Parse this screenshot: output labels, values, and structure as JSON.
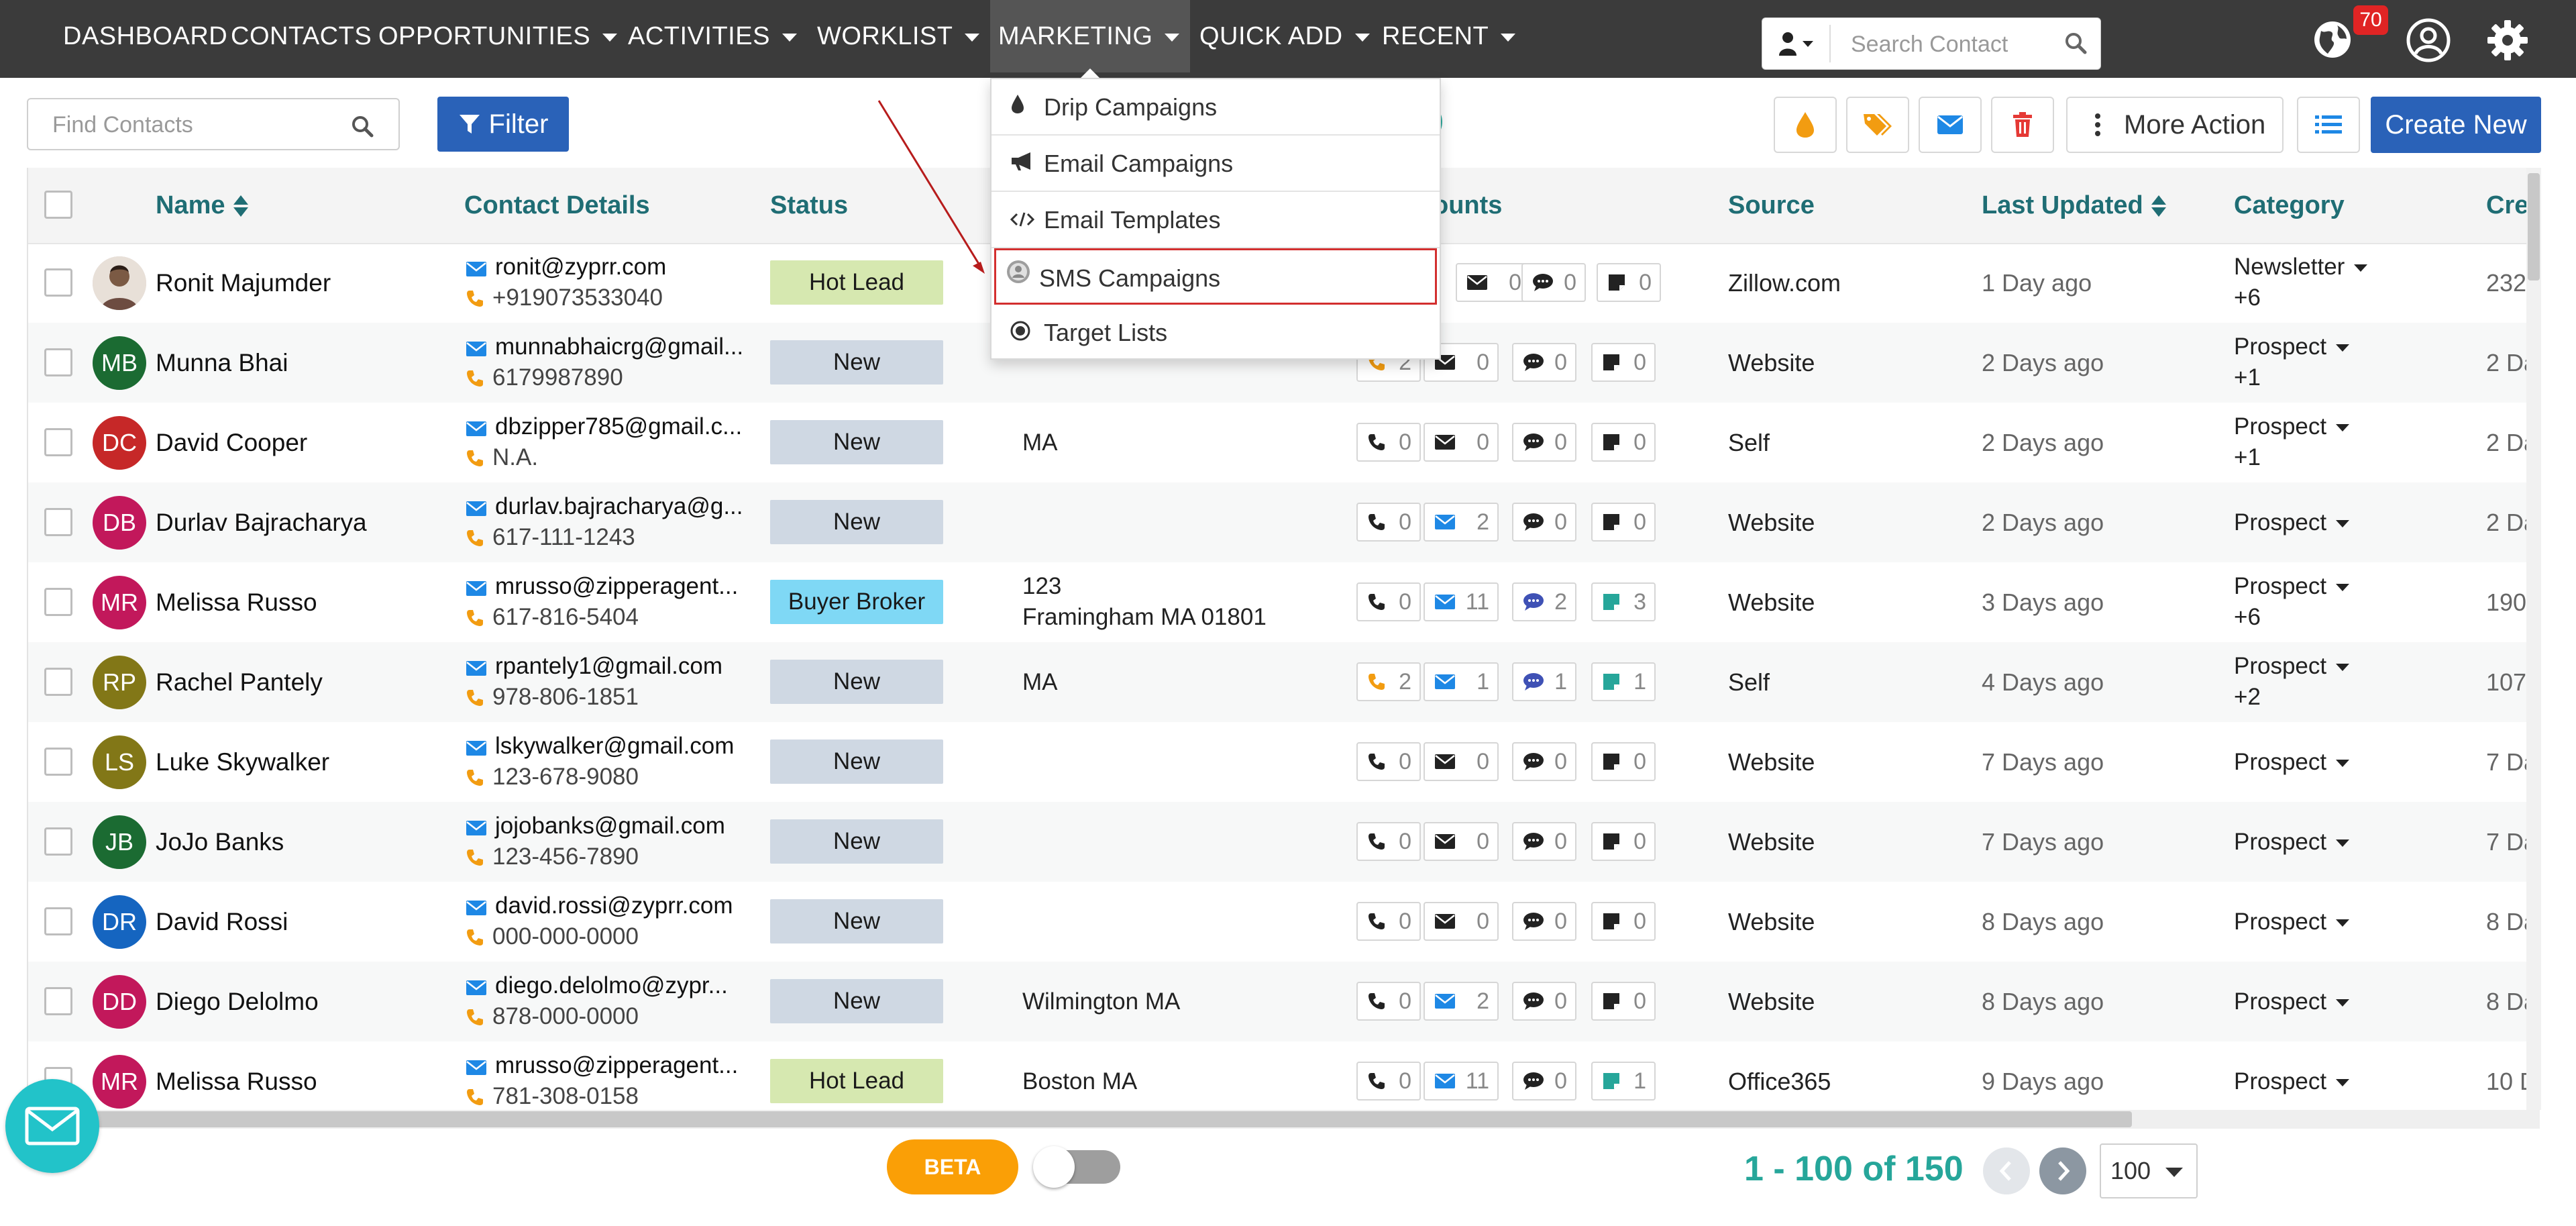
{
  "nav": {
    "items": [
      {
        "label": "DASHBOARD",
        "dropdown": false
      },
      {
        "label": "CONTACTS",
        "dropdown": false
      },
      {
        "label": "OPPORTUNITIES",
        "dropdown": true
      },
      {
        "label": "ACTIVITIES",
        "dropdown": true
      },
      {
        "label": "WORKLIST",
        "dropdown": true
      },
      {
        "label": "MARKETING",
        "dropdown": true,
        "active": true
      },
      {
        "label": "QUICK ADD",
        "dropdown": true
      },
      {
        "label": "RECENT",
        "dropdown": true
      }
    ],
    "search_placeholder": "Search Contact",
    "notification_count": "70",
    "icons": [
      "user-icon",
      "search-icon",
      "globe-icon",
      "account-circle-icon",
      "gear-icon"
    ]
  },
  "toolbar": {
    "find_placeholder": "Find Contacts",
    "filter_label": "Filter",
    "title_fragment": "s)",
    "more_action_label": "More Action",
    "create_new_label": "Create New",
    "icon_buttons": [
      "drip-icon",
      "tag-icon",
      "email-icon",
      "trash-icon"
    ]
  },
  "marketing_menu": {
    "items": [
      {
        "label": "Drip Campaigns",
        "icon": "drip-icon"
      },
      {
        "label": "Email Campaigns",
        "icon": "megaphone-icon"
      },
      {
        "label": "Email Templates",
        "icon": "code-icon"
      },
      {
        "label": "SMS Campaigns",
        "icon": "sms-icon",
        "highlighted": true
      },
      {
        "label": "Target Lists",
        "icon": "target-icon"
      }
    ]
  },
  "table": {
    "columns": [
      "Name",
      "Contact Details",
      "Status",
      "ounts",
      "Source",
      "Last Updated",
      "Category",
      "Cre"
    ],
    "rows": [
      {
        "initials": "",
        "photo": true,
        "color": "#6d4c41",
        "name": "Ronit Majumder",
        "email": "ronit@zyprr.com",
        "phone": "+919073533040",
        "status": "Hot Lead",
        "addr1": "",
        "addr2": "",
        "calls": "",
        "emails": "0",
        "sms": "0",
        "notes": "0",
        "source": "Zillow.com",
        "updated": "1 Day ago",
        "category": "Newsletter",
        "cat_more": "+6",
        "created": "232"
      },
      {
        "initials": "MB",
        "color": "#1b6b32",
        "name": "Munna Bhai",
        "email": "munnabhaicrg@gmail...",
        "phone": "6179987890",
        "status": "New",
        "addr1": "",
        "addr2": "",
        "calls": "2",
        "emails": "0",
        "sms": "0",
        "notes": "0",
        "source": "Website",
        "updated": "2 Days ago",
        "category": "Prospect",
        "cat_more": "+1",
        "created": "2 Da"
      },
      {
        "initials": "DC",
        "color": "#c62828",
        "name": "David Cooper",
        "email": "dbzipper785@gmail.c...",
        "phone": "N.A.",
        "status": "New",
        "addr1": "MA",
        "addr2": "",
        "calls": "0",
        "emails": "0",
        "sms": "0",
        "notes": "0",
        "source": "Self",
        "updated": "2 Days ago",
        "category": "Prospect",
        "cat_more": "+1",
        "created": "2 Da"
      },
      {
        "initials": "DB",
        "color": "#c2185b",
        "name": "Durlav Bajracharya",
        "email": "durlav.bajracharya@g...",
        "phone": "617-111-1243",
        "status": "New",
        "addr1": "",
        "addr2": "",
        "calls": "0",
        "emails": "2",
        "sms": "0",
        "notes": "0",
        "source": "Website",
        "updated": "2 Days ago",
        "category": "Prospect",
        "cat_more": "",
        "created": "2 Da"
      },
      {
        "initials": "MR",
        "color": "#c2185b",
        "name": "Melissa Russo",
        "email": "mrusso@zipperagent...",
        "phone": "617-816-5404",
        "status": "Buyer Broker",
        "addr1": "123",
        "addr2": "Framingham MA 01801",
        "calls": "0",
        "emails": "11",
        "sms": "2",
        "notes": "3",
        "source": "Website",
        "updated": "3 Days ago",
        "category": "Prospect",
        "cat_more": "+6",
        "created": "190"
      },
      {
        "initials": "RP",
        "color": "#827717",
        "name": "Rachel Pantely",
        "email": "rpantely1@gmail.com",
        "phone": "978-806-1851",
        "status": "New",
        "addr1": "MA",
        "addr2": "",
        "calls": "2",
        "emails": "1",
        "sms": "1",
        "notes": "1",
        "source": "Self",
        "updated": "4 Days ago",
        "category": "Prospect",
        "cat_more": "+2",
        "created": "107"
      },
      {
        "initials": "LS",
        "color": "#827717",
        "name": "Luke Skywalker",
        "email": "lskywalker@gmail.com",
        "phone": "123-678-9080",
        "status": "New",
        "addr1": "",
        "addr2": "",
        "calls": "0",
        "emails": "0",
        "sms": "0",
        "notes": "0",
        "source": "Website",
        "updated": "7 Days ago",
        "category": "Prospect",
        "cat_more": "",
        "created": "7 Da"
      },
      {
        "initials": "JB",
        "color": "#1b6b32",
        "name": "JoJo Banks",
        "email": "jojobanks@gmail.com",
        "phone": "123-456-7890",
        "status": "New",
        "addr1": "",
        "addr2": "",
        "calls": "0",
        "emails": "0",
        "sms": "0",
        "notes": "0",
        "source": "Website",
        "updated": "7 Days ago",
        "category": "Prospect",
        "cat_more": "",
        "created": "7 Da"
      },
      {
        "initials": "DR",
        "color": "#1565c0",
        "name": "David Rossi",
        "email": "david.rossi@zyprr.com",
        "phone": "000-000-0000",
        "status": "New",
        "addr1": "",
        "addr2": "",
        "calls": "0",
        "emails": "0",
        "sms": "0",
        "notes": "0",
        "source": "Website",
        "updated": "8 Days ago",
        "category": "Prospect",
        "cat_more": "",
        "created": "8 Da"
      },
      {
        "initials": "DD",
        "color": "#c2185b",
        "name": "Diego Delolmo",
        "email": "diego.delolmo@zypr...",
        "phone": "878-000-0000",
        "status": "New",
        "addr1": "Wilmington MA",
        "addr2": "",
        "calls": "0",
        "emails": "2",
        "sms": "0",
        "notes": "0",
        "source": "Website",
        "updated": "8 Days ago",
        "category": "Prospect",
        "cat_more": "",
        "created": "8 Da"
      },
      {
        "initials": "MR",
        "color": "#c2185b",
        "name": "Melissa Russo",
        "email": "mrusso@zipperagent...",
        "phone": "781-308-0158",
        "status": "Hot Lead",
        "addr1": "Boston MA",
        "addr2": "",
        "calls": "0",
        "emails": "11",
        "sms": "0",
        "notes": "1",
        "source": "Office365",
        "updated": "9 Days ago",
        "category": "Prospect",
        "cat_more": "",
        "created": "10 D"
      }
    ]
  },
  "status_colors": {
    "Hot Lead": "#d6e8b0",
    "New": "#cfd8e3",
    "Buyer Broker": "#7fd8f5"
  },
  "footer": {
    "beta_label": "BETA",
    "pagination_text": "1 - 100 of 150",
    "page_size": "100"
  },
  "colors": {
    "nav_bg": "#3b3b3b",
    "primary": "#2a62b8",
    "accent": "#26a69a",
    "header_text": "#1f6d74",
    "highlight_border": "#d32f2f"
  }
}
